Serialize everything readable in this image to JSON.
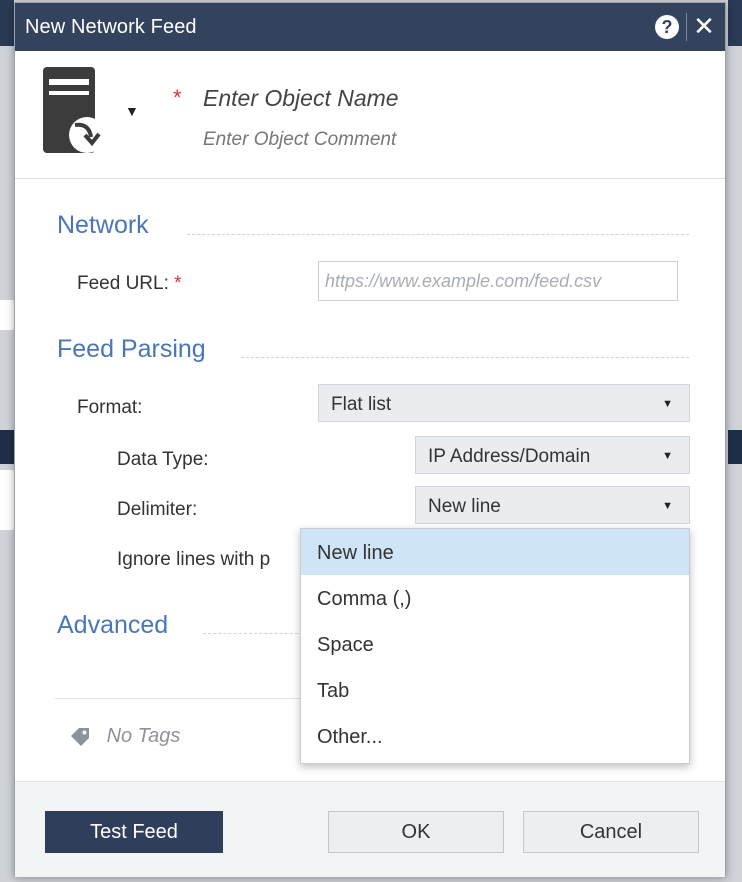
{
  "dialog": {
    "title": "New Network Feed",
    "help_icon": "question-circle-icon",
    "close_icon": "close-icon"
  },
  "header": {
    "object_icon": "network-feed-object-icon",
    "required_mark": "*",
    "object_name_placeholder": "Enter Object Name",
    "object_comment_placeholder": "Enter Object Comment"
  },
  "network": {
    "section_title": "Network",
    "feed_url_label": "Feed URL:",
    "feed_url_required": "*",
    "feed_url_value": "",
    "feed_url_placeholder": "https://www.example.com/feed.csv"
  },
  "feed_parsing": {
    "section_title": "Feed Parsing",
    "format_label": "Format:",
    "format_value": "Flat list",
    "data_type_label": "Data Type:",
    "data_type_value": "IP Address/Domain",
    "delimiter_label": "Delimiter:",
    "delimiter_value": "New line",
    "ignore_lines_label": "Ignore lines with p"
  },
  "delimiter_options": [
    {
      "label": "New line",
      "selected": true
    },
    {
      "label": "Comma (,)",
      "selected": false
    },
    {
      "label": "Space",
      "selected": false
    },
    {
      "label": "Tab",
      "selected": false
    },
    {
      "label": "Other...",
      "selected": false
    }
  ],
  "advanced": {
    "section_title": "Advanced"
  },
  "tags": {
    "icon": "tag-icon",
    "text": "No Tags"
  },
  "footer": {
    "test_feed_label": "Test Feed",
    "ok_label": "OK",
    "cancel_label": "Cancel"
  },
  "colors": {
    "titlebar": "#33425d",
    "section_title": "#4a77b4",
    "required": "#d9333f",
    "selected_option": "#cfe5f7",
    "primary_button": "#2f3e5b"
  }
}
